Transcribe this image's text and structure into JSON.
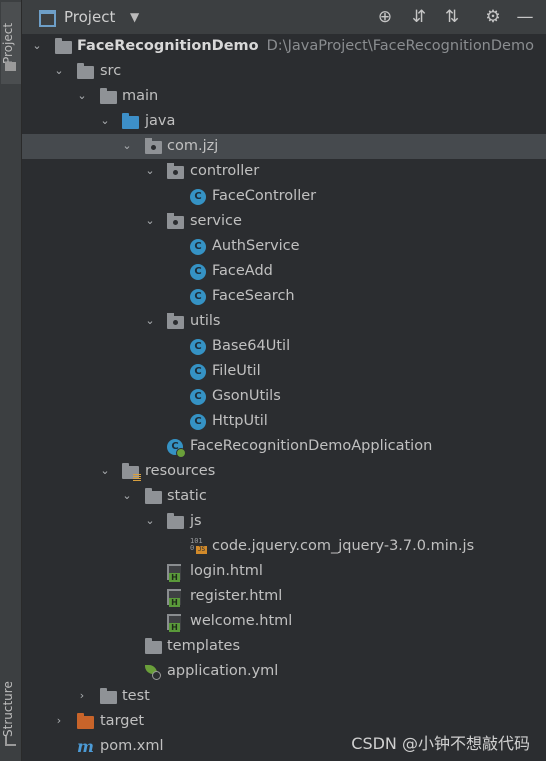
{
  "sidebar": {
    "project_tab": "Project",
    "structure_tab": "Structure"
  },
  "header": {
    "title": "Project",
    "dropdown_icon": "triangle-down-icon",
    "tools": [
      "locate-icon",
      "expand-all-icon",
      "collapse-all-icon",
      "gear-icon",
      "hide-icon"
    ]
  },
  "tree": {
    "project": {
      "name": "FaceRecognitionDemo",
      "path": "D:\\JavaProject\\FaceRecognitionDemo"
    },
    "src": "src",
    "main": "main",
    "java": "java",
    "pkg": "com.jzj",
    "controller": "controller",
    "face_controller": "FaceController",
    "service": "service",
    "auth_service": "AuthService",
    "face_add": "FaceAdd",
    "face_search": "FaceSearch",
    "utils": "utils",
    "base64_util": "Base64Util",
    "file_util": "FileUtil",
    "gson_utils": "GsonUtils",
    "http_util": "HttpUtil",
    "app": "FaceRecognitionDemoApplication",
    "resources": "resources",
    "static": "static",
    "js": "js",
    "jquery": "code.jquery.com_jquery-3.7.0.min.js",
    "login": "login.html",
    "register": "register.html",
    "welcome": "welcome.html",
    "templates": "templates",
    "app_yml": "application.yml",
    "test": "test",
    "target": "target",
    "pom": "pom.xml"
  },
  "selected_item": "com.jzj",
  "watermark": "CSDN @小钟不想敲代码",
  "colors": {
    "background": "#2b2d30",
    "selection": "#464a4e",
    "class_icon": "#3592c4",
    "target_folder": "#c8642a"
  }
}
